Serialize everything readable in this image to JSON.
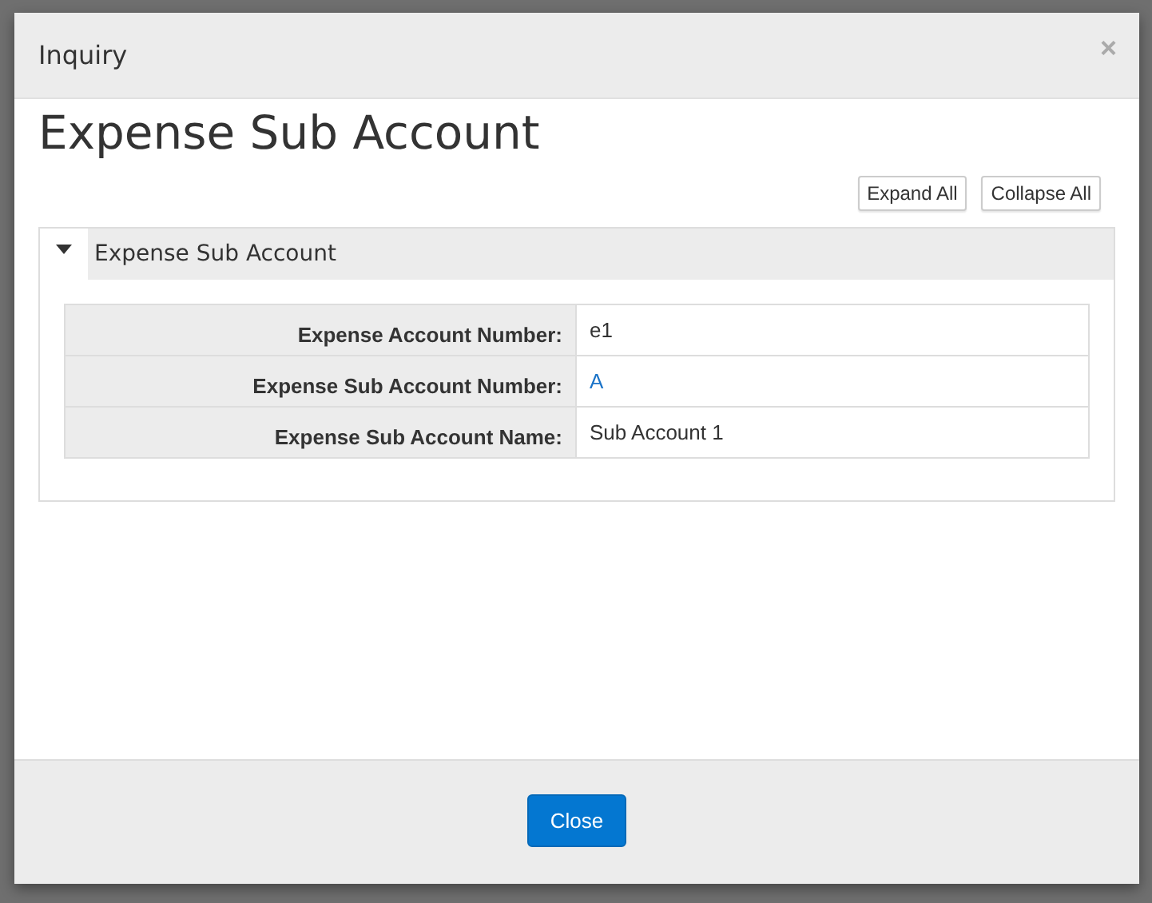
{
  "dialog": {
    "title": "Inquiry",
    "close_icon": "×",
    "heading": "Expense Sub Account",
    "toolbar": [
      "Expand All",
      "Collapse All"
    ],
    "section": {
      "title": "Expense Sub Account",
      "expanded": true,
      "fields": [
        {
          "label": "Expense Account Number:",
          "value": "e1",
          "kind": "text"
        },
        {
          "label": "Expense Sub Account Number:",
          "value": "A",
          "kind": "link"
        },
        {
          "label": "Expense Sub Account Name:",
          "value": "Sub Account 1",
          "kind": "text"
        }
      ]
    },
    "footer_button": "Close"
  }
}
